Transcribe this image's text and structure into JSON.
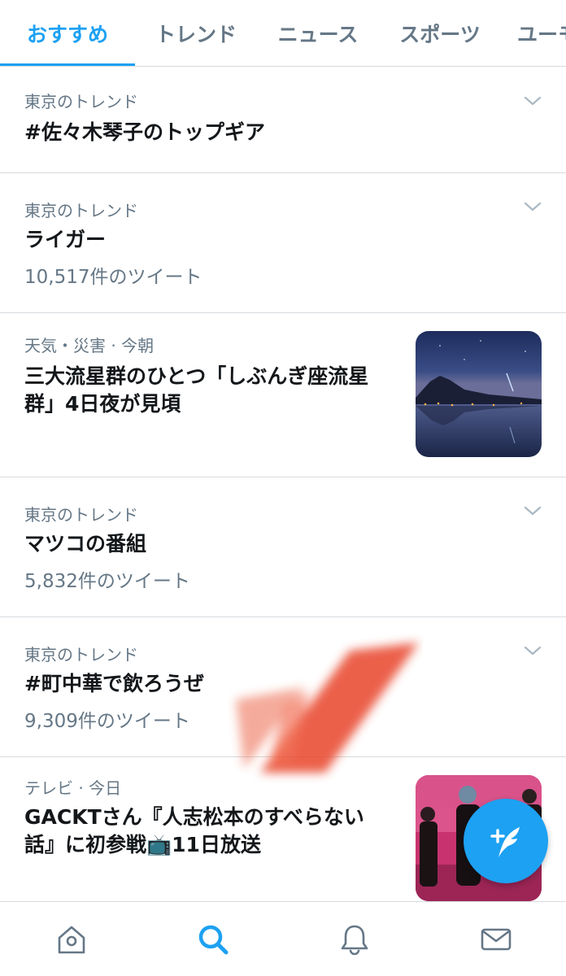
{
  "tabs": [
    {
      "label": "おすすめ",
      "active": true
    },
    {
      "label": "トレンド",
      "active": false
    },
    {
      "label": "ニュース",
      "active": false
    },
    {
      "label": "スポーツ",
      "active": false
    },
    {
      "label": "ユーモア",
      "active": false
    }
  ],
  "feed": [
    {
      "meta": "東京のトレンド",
      "title": "#佐々木琴子のトップギア",
      "count": ""
    },
    {
      "meta": "東京のトレンド",
      "title": "ライガー",
      "count": "10,517件のツイート"
    },
    {
      "meta": "天気・災害 · 今朝",
      "title_line1": "三大流星群のひとつ「しぶんぎ座流星",
      "title_line2": "群」4日夜が見頃",
      "thumbnail": "night-lake-meteor-photo"
    },
    {
      "meta": "東京のトレンド",
      "title": "マツコの番組",
      "count": "5,832件のツイート"
    },
    {
      "meta": "東京のトレンド",
      "title": "#町中華で飲ろうぜ",
      "count": "9,309件のツイート"
    },
    {
      "meta": "テレビ · 今日",
      "title_line1": "GACKTさん『人志松本のすべらない",
      "title_line2a": "話』に初参戦",
      "title_emoji": "📺",
      "title_line2b": "11日放送",
      "thumbnail": "tv-show-stage-photo"
    }
  ],
  "icons": {
    "chevron": "chevron-down-icon",
    "compose": "compose-tweet-icon",
    "home": "home-icon",
    "search": "search-icon",
    "notifications": "bell-icon",
    "messages": "envelope-icon"
  },
  "colors": {
    "accent": "#1da1f2",
    "text_primary": "#14171a",
    "text_secondary": "#657786",
    "divider": "#d6dbdf",
    "scribble": "#e8492b"
  }
}
